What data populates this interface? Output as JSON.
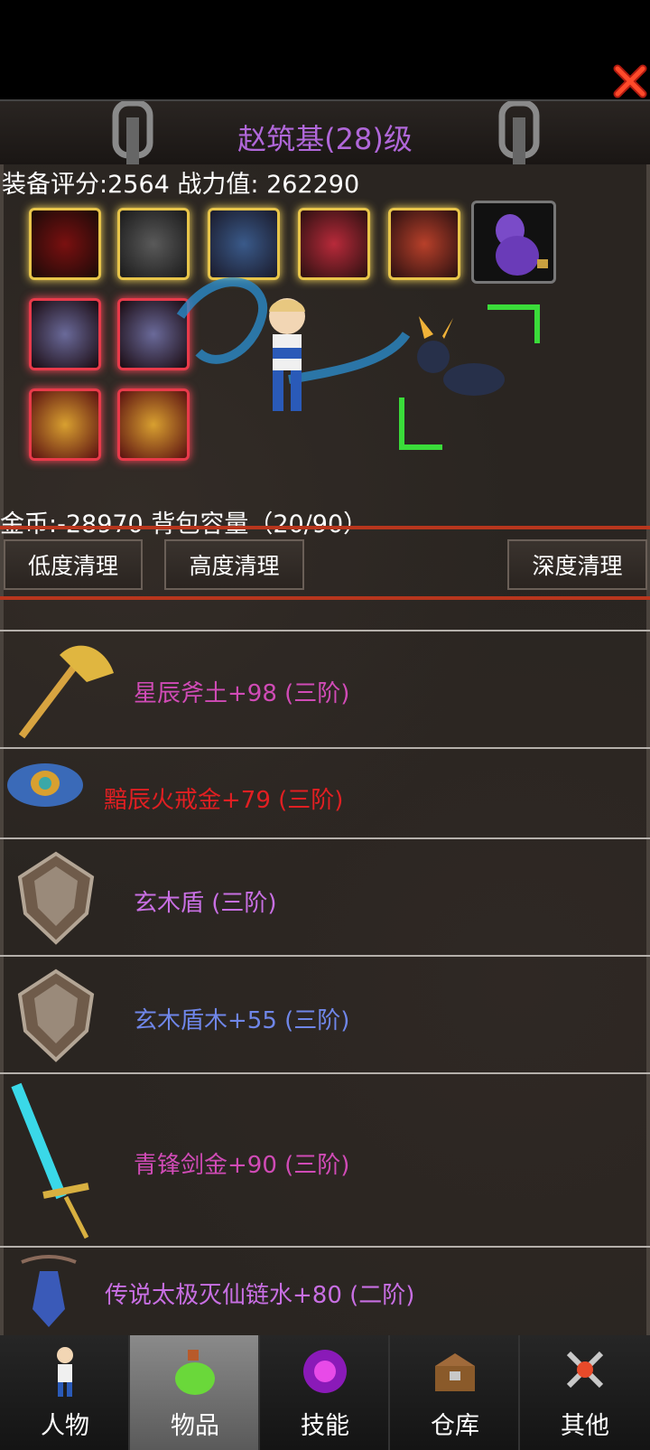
{
  "header": {
    "title": "赵筑基(28)级"
  },
  "stats": {
    "text": "装备评分:2564 战力值: 262290"
  },
  "inventory": {
    "gold_text": "金币:-28970 背包容量（20/90）"
  },
  "cleanup": {
    "low": "低度清理",
    "high": "高度清理",
    "deep": "深度清理"
  },
  "items": [
    {
      "name": "星辰斧土+98 (三阶)",
      "color": "#d04bb6"
    },
    {
      "name": "黯辰火戒金+79 (三阶)",
      "color": "#e11f22"
    },
    {
      "name": "玄木盾 (三阶)",
      "color": "#c86fe3"
    },
    {
      "name": "玄木盾木+55 (三阶)",
      "color": "#6f86e8"
    },
    {
      "name": "青锋剑金+90 (三阶)",
      "color": "#d04bb6"
    },
    {
      "name": "传说太极灭仙链水+80 (二阶)",
      "color": "#c86fe3"
    }
  ],
  "tabs": [
    {
      "label": "人物"
    },
    {
      "label": "物品"
    },
    {
      "label": "技能"
    },
    {
      "label": "仓库"
    },
    {
      "label": "其他"
    }
  ],
  "colors": {
    "accent_purple": "#b067d9",
    "cleanup_red": "#b8361d",
    "active_tab": "#7a7a7a"
  }
}
